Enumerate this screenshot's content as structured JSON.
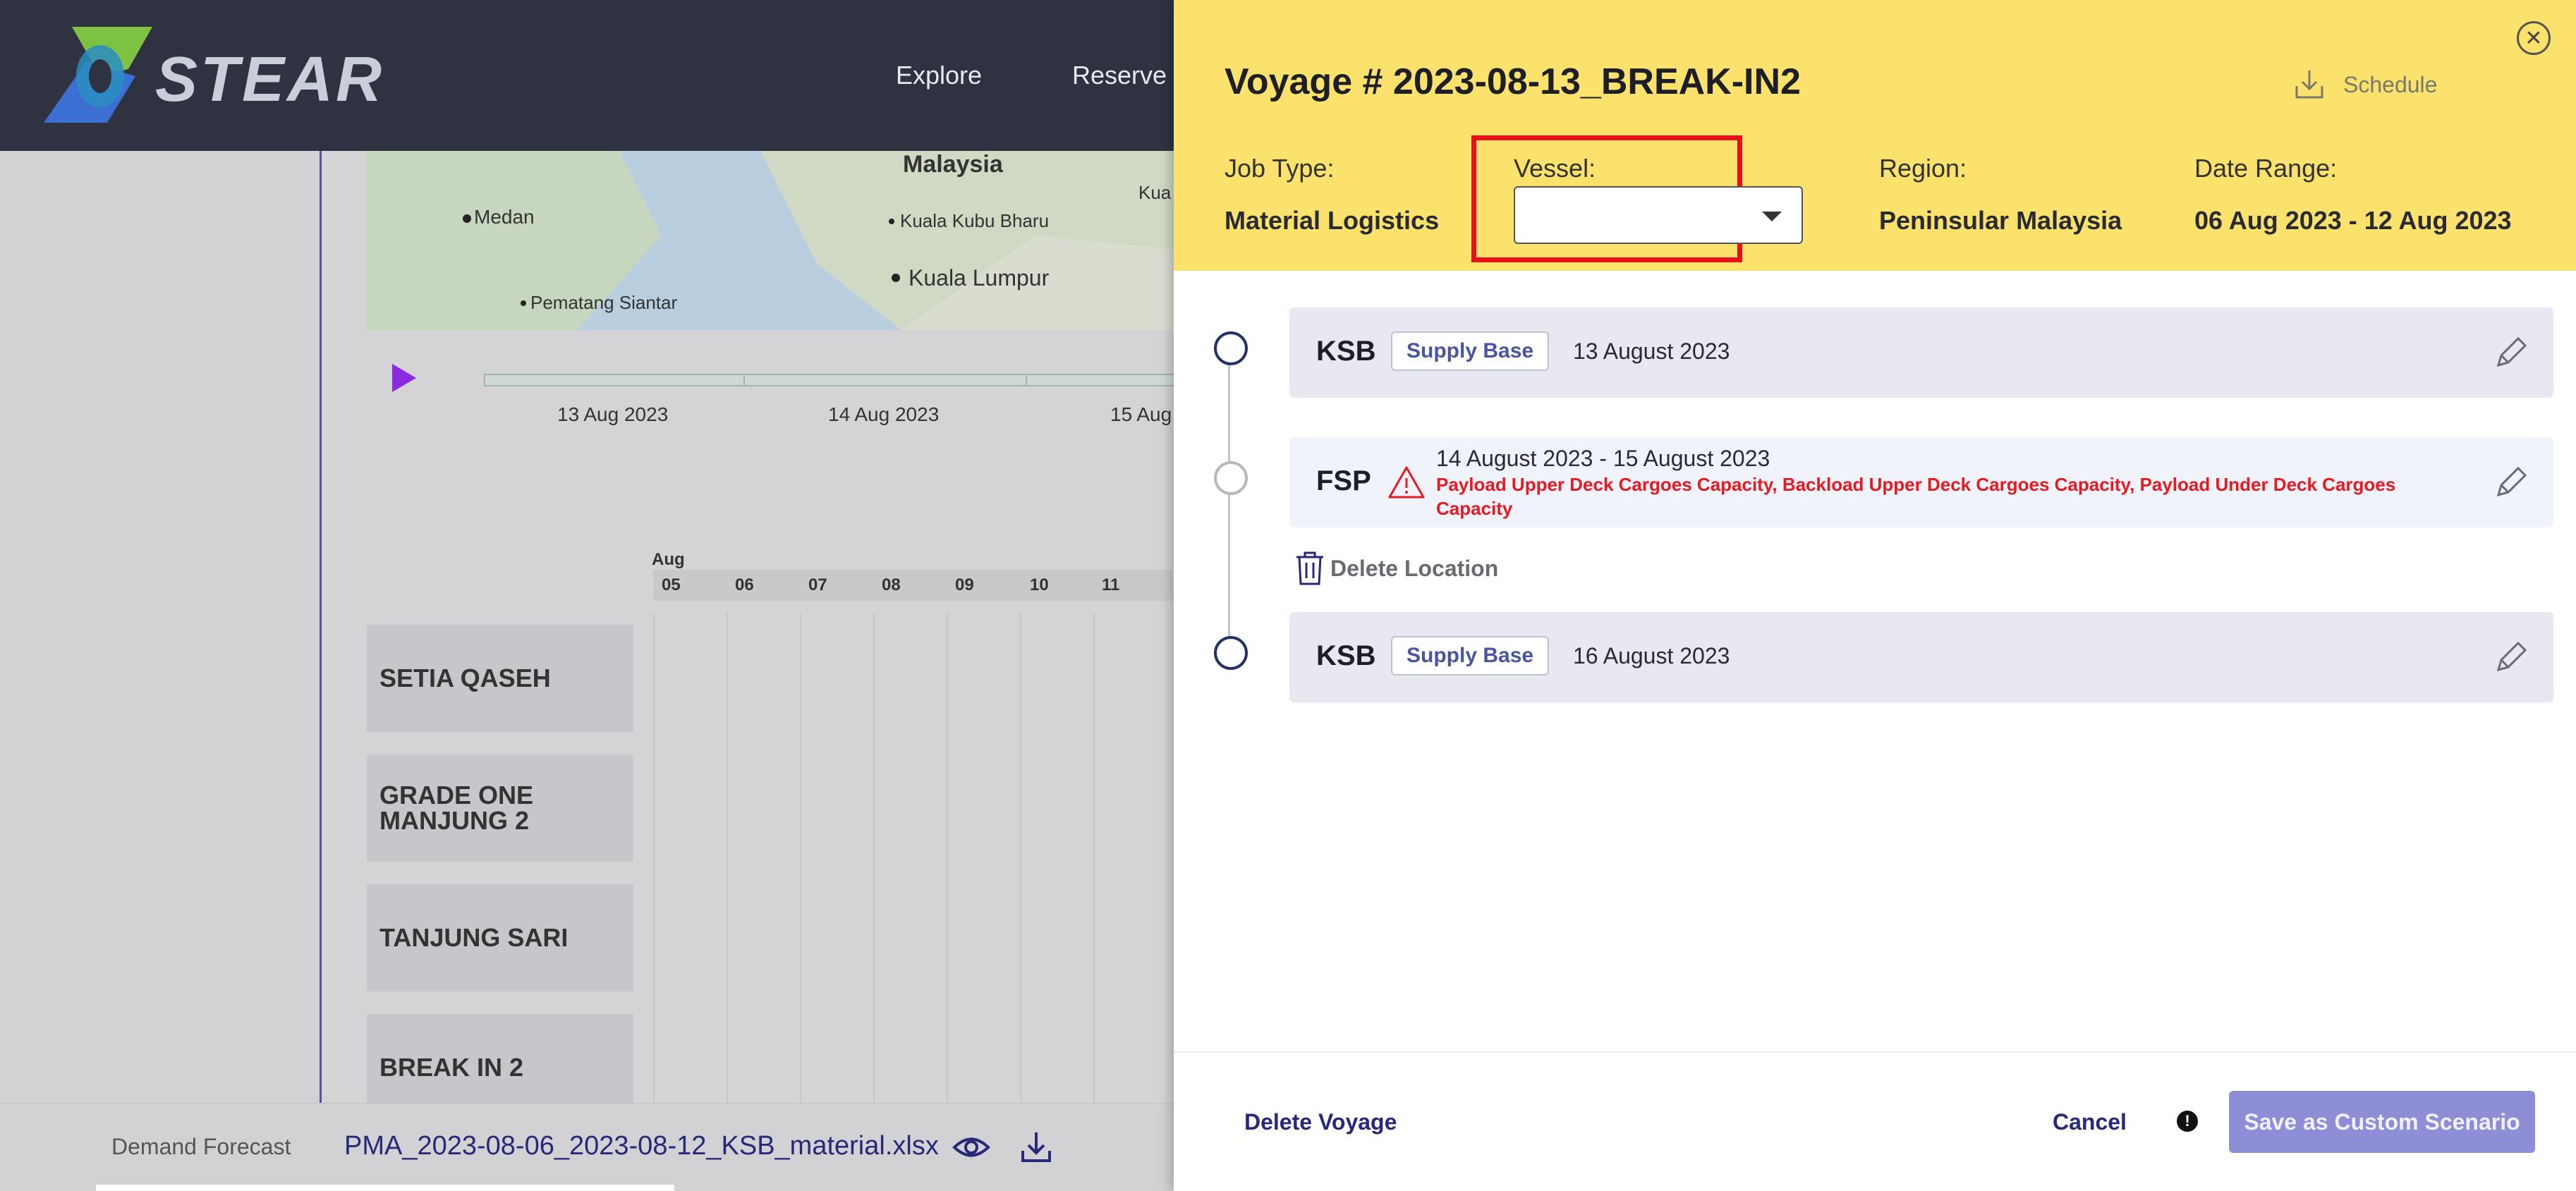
{
  "app": {
    "logo_text": "STEAR",
    "nav": [
      "Explore",
      "Reserve"
    ]
  },
  "map": {
    "labels": [
      "Malaysia",
      "Medan",
      "Kuala Kubu Bharu",
      "Kuala Lumpur",
      "Pematang Siantar",
      "Kua"
    ]
  },
  "timeline": {
    "dates": [
      "13 Aug 2023",
      "14 Aug 2023",
      "15 Aug"
    ]
  },
  "gantt": {
    "month": "Aug",
    "days": [
      "05",
      "06",
      "07",
      "08",
      "09",
      "10",
      "11"
    ],
    "rows": [
      "SETIA QASEH",
      "GRADE ONE MANJUNG 2",
      "TANJUNG SARI",
      "BREAK IN 2"
    ]
  },
  "bottom": {
    "label": "Demand Forecast",
    "file": "PMA_2023-08-06_2023-08-12_KSB_material.xlsx",
    "icons": [
      "eye-icon",
      "download-icon"
    ]
  },
  "drawer": {
    "title": "Voyage # 2023-08-13_BREAK-IN2",
    "schedule_label": "Schedule",
    "fields": {
      "job_type_label": "Job Type:",
      "job_type_value": "Material Logistics",
      "vessel_label": "Vessel:",
      "vessel_value": "",
      "region_label": "Region:",
      "region_value": "Peninsular Malaysia",
      "date_range_label": "Date Range:",
      "date_range_value": "06 Aug 2023 - 12 Aug 2023"
    },
    "stops": [
      {
        "code": "KSB",
        "tag": "Supply Base",
        "date": "13 August 2023"
      },
      {
        "code": "FSP",
        "date": "14 August 2023 - 15 August 2023",
        "error": "Payload Upper Deck Cargoes Capacity, Backload Upper Deck Cargoes Capacity, Payload Under Deck Cargoes Capacity"
      },
      {
        "code": "KSB",
        "tag": "Supply Base",
        "date": "16 August 2023"
      }
    ],
    "delete_location": "Delete Location",
    "footer": {
      "delete_voyage": "Delete Voyage",
      "cancel": "Cancel",
      "save": "Save as Custom Scenario"
    },
    "colors": {
      "header": "#fae26c",
      "error": "#e51a22",
      "accent": "#27287a",
      "highlight": "#e8101a"
    }
  }
}
